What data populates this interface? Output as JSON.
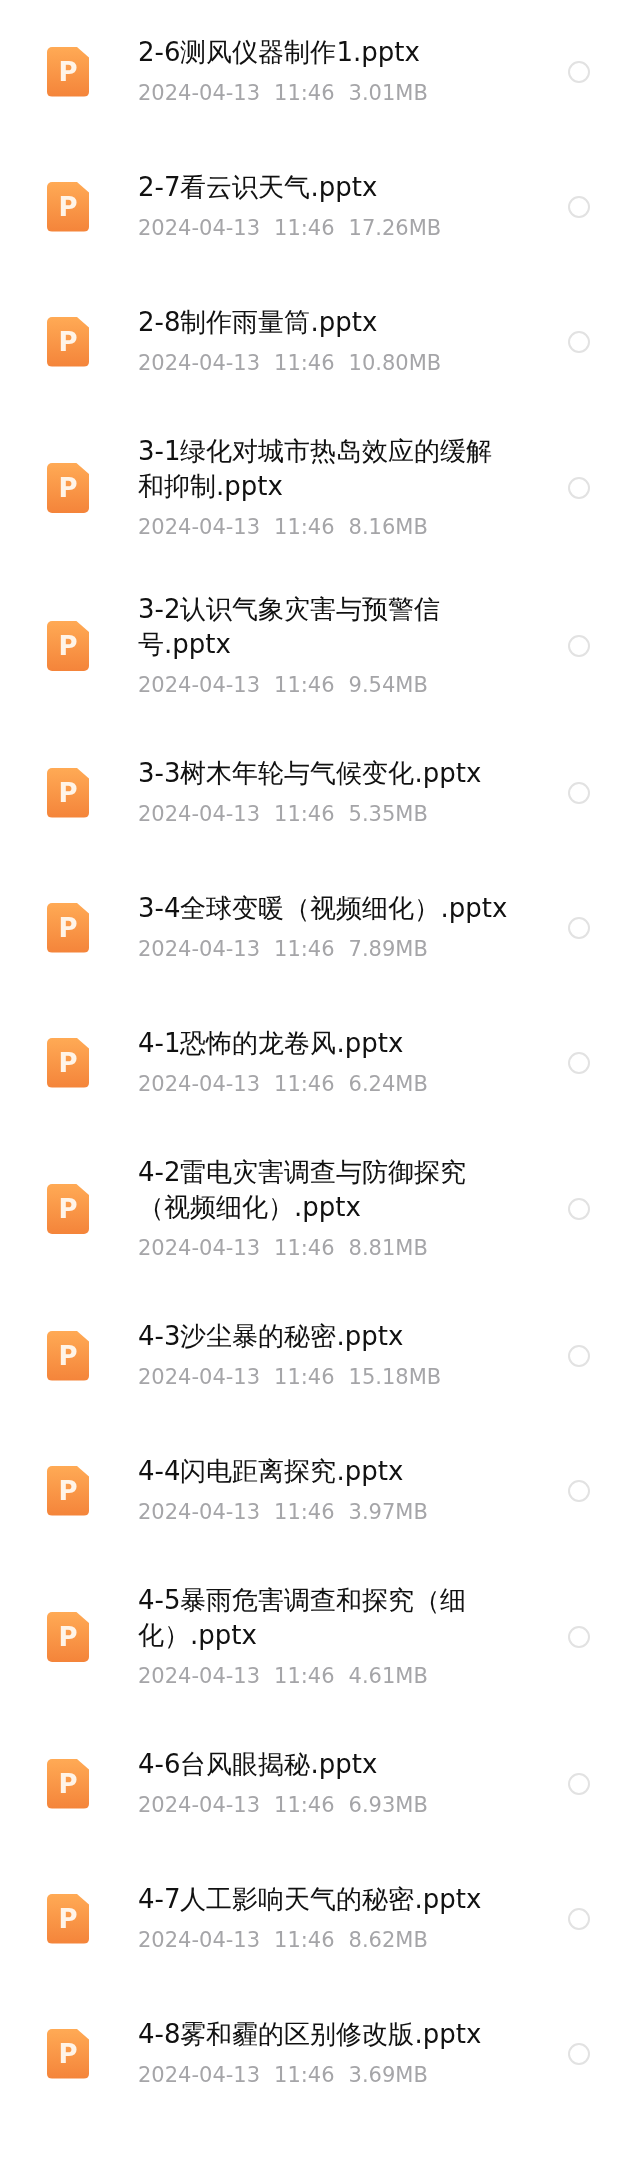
{
  "files": [
    {
      "icon": "P",
      "name": "2-6测风仪器制作1.pptx",
      "date": "2024-04-13",
      "time": "11:46",
      "size": "3.01MB",
      "selected": false
    },
    {
      "icon": "P",
      "name": "2-7看云识天气.pptx",
      "date": "2024-04-13",
      "time": "11:46",
      "size": "17.26MB",
      "selected": false
    },
    {
      "icon": "P",
      "name": "2-8制作雨量筒.pptx",
      "date": "2024-04-13",
      "time": "11:46",
      "size": "10.80MB",
      "selected": false
    },
    {
      "icon": "P",
      "name": "3-1绿化对城市热岛效应的缓解和抑制.pptx",
      "date": "2024-04-13",
      "time": "11:46",
      "size": "8.16MB",
      "selected": false
    },
    {
      "icon": "P",
      "name": "3-2认识气象灾害与预警信号.pptx",
      "date": "2024-04-13",
      "time": "11:46",
      "size": "9.54MB",
      "selected": false
    },
    {
      "icon": "P",
      "name": "3-3树木年轮与气候变化.pptx",
      "date": "2024-04-13",
      "time": "11:46",
      "size": "5.35MB",
      "selected": false
    },
    {
      "icon": "P",
      "name": "3-4全球变暖（视频细化）.pptx",
      "date": "2024-04-13",
      "time": "11:46",
      "size": "7.89MB",
      "selected": false
    },
    {
      "icon": "P",
      "name": "4-1恐怖的龙卷风.pptx",
      "date": "2024-04-13",
      "time": "11:46",
      "size": "6.24MB",
      "selected": false
    },
    {
      "icon": "P",
      "name": "4-2雷电灾害调查与防御探究（视频细化）.pptx",
      "date": "2024-04-13",
      "time": "11:46",
      "size": "8.81MB",
      "selected": false
    },
    {
      "icon": "P",
      "name": "4-3沙尘暴的秘密.pptx",
      "date": "2024-04-13",
      "time": "11:46",
      "size": "15.18MB",
      "selected": false
    },
    {
      "icon": "P",
      "name": "4-4闪电距离探究.pptx",
      "date": "2024-04-13",
      "time": "11:46",
      "size": "3.97MB",
      "selected": false
    },
    {
      "icon": "P",
      "name": "4-5暴雨危害调查和探究（细化）.pptx",
      "date": "2024-04-13",
      "time": "11:46",
      "size": "4.61MB",
      "selected": false
    },
    {
      "icon": "P",
      "name": "4-6台风眼揭秘.pptx",
      "date": "2024-04-13",
      "time": "11:46",
      "size": "6.93MB",
      "selected": false
    },
    {
      "icon": "P",
      "name": "4-7人工影响天气的秘密.pptx",
      "date": "2024-04-13",
      "time": "11:46",
      "size": "8.62MB",
      "selected": false
    },
    {
      "icon": "P",
      "name": "4-8雾和霾的区别修改版.pptx",
      "date": "2024-04-13",
      "time": "11:46",
      "size": "3.69MB",
      "selected": false
    }
  ]
}
